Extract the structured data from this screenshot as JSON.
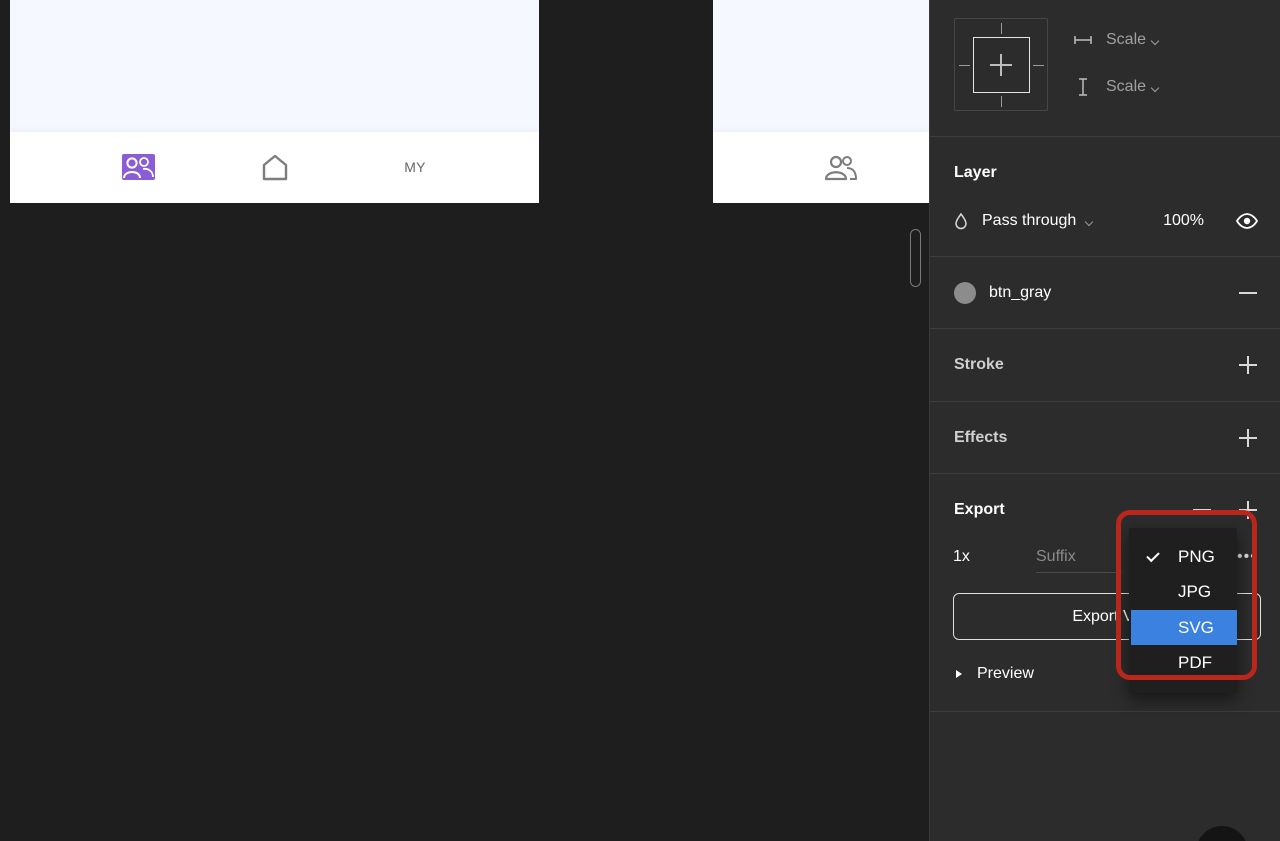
{
  "canvas": {
    "tab_my_label": "MY"
  },
  "constraints": {
    "horizontal": "Scale",
    "vertical": "Scale"
  },
  "layer": {
    "title": "Layer",
    "blend_mode": "Pass through",
    "opacity": "100%"
  },
  "fill": {
    "style_name": "btn_gray",
    "swatch_color": "#8c8c8c"
  },
  "stroke": {
    "title": "Stroke"
  },
  "effects": {
    "title": "Effects"
  },
  "export": {
    "title": "Export",
    "scale": "1x",
    "suffix_placeholder": "Suffix",
    "button_label": "Export Ve",
    "preview_label": "Preview"
  },
  "format_dropdown": {
    "options": [
      "PNG",
      "JPG",
      "SVG",
      "PDF"
    ],
    "checked": "PNG",
    "highlighted": "SVG"
  },
  "colors": {
    "accent": "#3b82e0",
    "tab_active": "#8a5cd6",
    "annotation_ring": "#b8261c"
  }
}
